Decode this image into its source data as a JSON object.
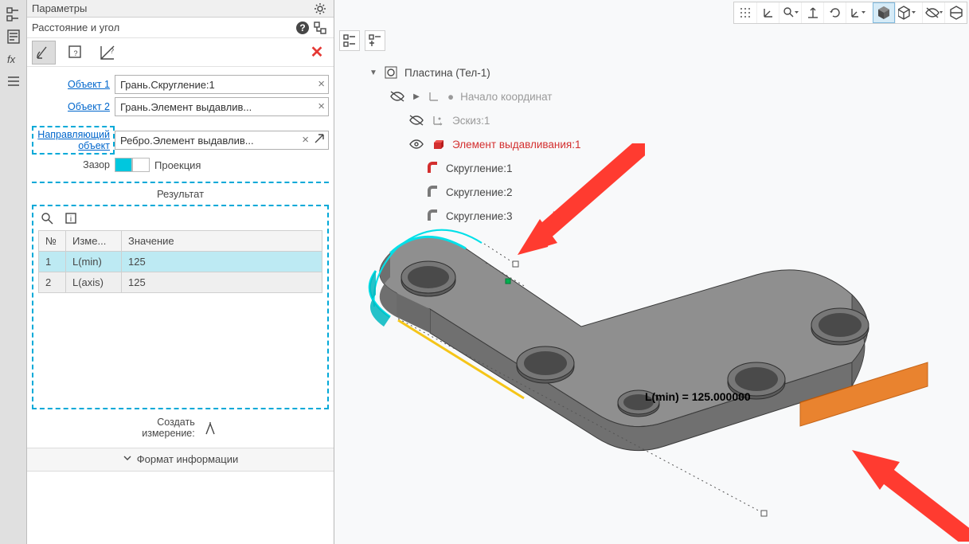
{
  "panel": {
    "title": "Параметры",
    "subtitle": "Расстояние и угол",
    "object1_label": "Объект 1",
    "object1_value": "Грань.Скругление:1",
    "object2_label": "Объект 2",
    "object2_value": "Грань.Элемент выдавлив...",
    "guide_label": "Направляющий объект",
    "guide_value": "Ребро.Элемент выдавлив...",
    "gap_label": "Зазор",
    "projection_label": "Проекция",
    "result_title": "Результат",
    "table": {
      "headers": {
        "num": "№",
        "meas": "Изме...",
        "val": "Значение"
      },
      "rows": [
        {
          "num": "1",
          "meas": "L(min)",
          "val": "125"
        },
        {
          "num": "2",
          "meas": "L(axis)",
          "val": "125"
        }
      ]
    },
    "create_meas_label": "Создать\nизмерение:",
    "fmt_info": "Формат информации"
  },
  "tree": {
    "root": "Пластина (Тел-1)",
    "origin": "Начало координат",
    "sketch": "Эскиз:1",
    "extrude": "Элемент выдавливания:1",
    "fillet1": "Скругление:1",
    "fillet2": "Скругление:2",
    "fillet3": "Скругление:3"
  },
  "viewport": {
    "measure_label": "L(min) = 125.000000"
  }
}
